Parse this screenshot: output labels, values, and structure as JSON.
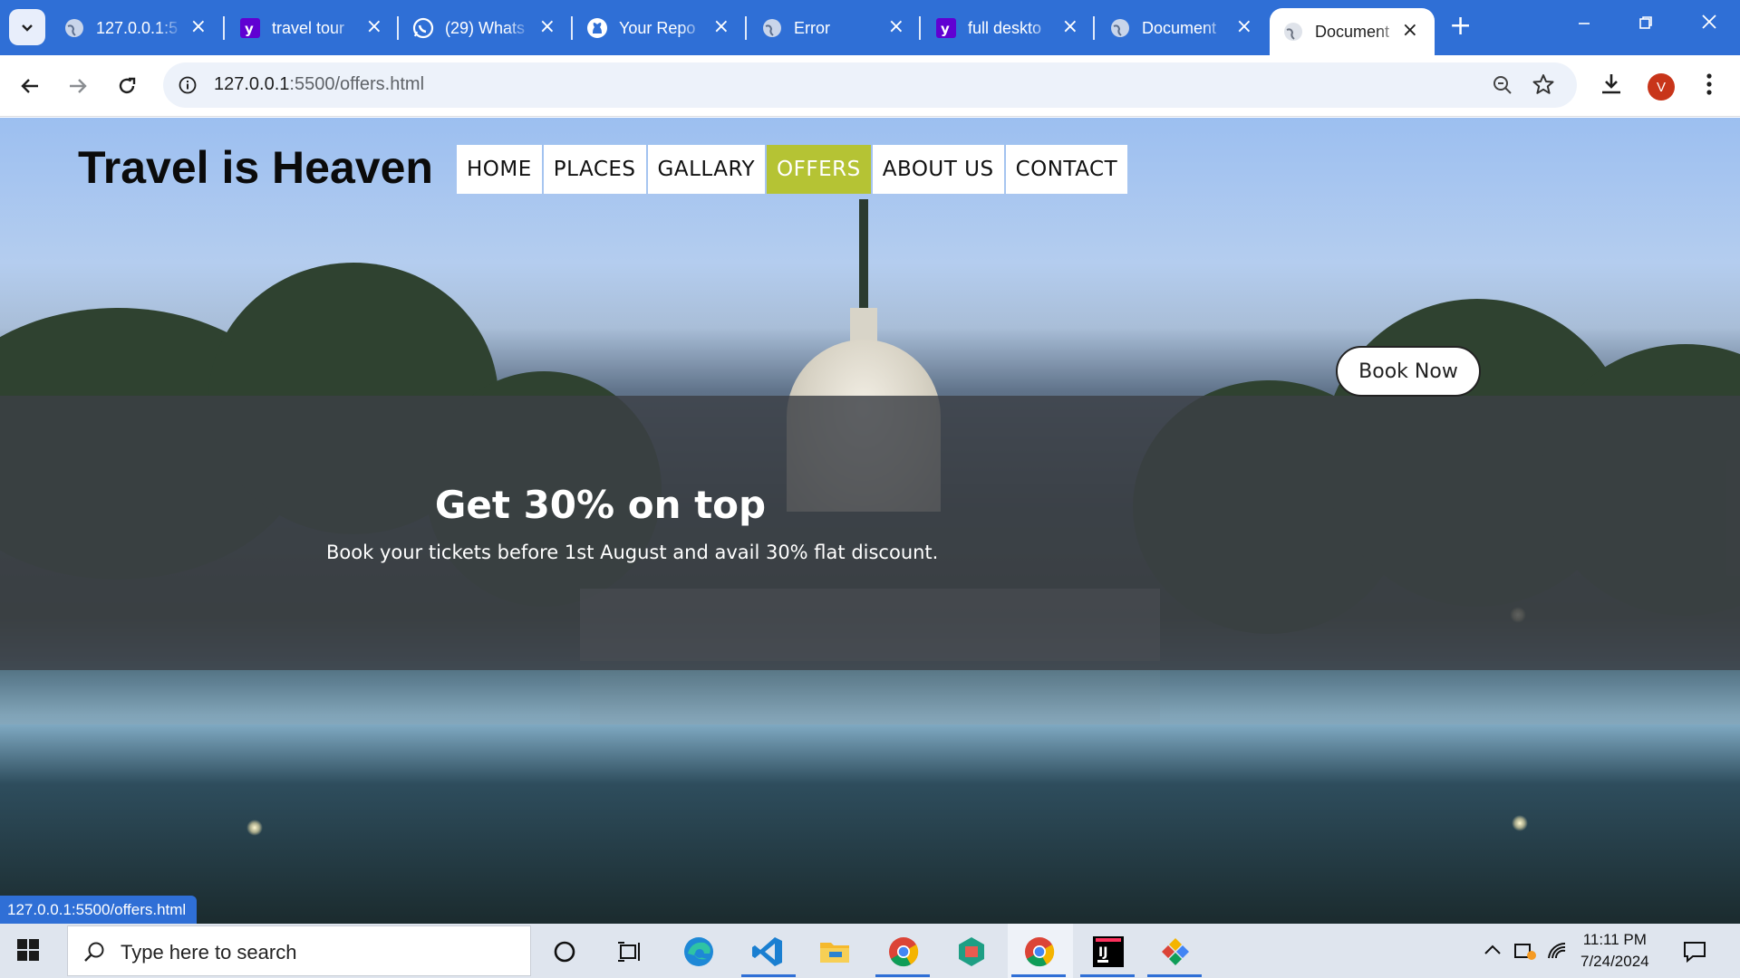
{
  "browser": {
    "tabs": [
      {
        "title": "127.0.0.1:5",
        "favicon": "globe-icon"
      },
      {
        "title": "travel tour",
        "favicon": "yahoo-icon"
      },
      {
        "title": "(29) Whats",
        "favicon": "whatsapp-icon"
      },
      {
        "title": "Your Repo",
        "favicon": "github-icon"
      },
      {
        "title": "Error",
        "favicon": "globe-icon"
      },
      {
        "title": "full deskto",
        "favicon": "yahoo-icon"
      },
      {
        "title": "Document",
        "favicon": "globe-icon"
      },
      {
        "title": "Document",
        "favicon": "globe-icon",
        "active": true
      }
    ],
    "url_host": "127.0.0.1",
    "url_rest": ":5500/offers.html",
    "profile_initial": "V",
    "status_url": "127.0.0.1:5500/offers.html"
  },
  "page": {
    "brand": "Travel is Heaven",
    "menu": [
      "HOME",
      "PLACES",
      "GALLARY",
      "OFFERS",
      "ABOUT US",
      "CONTACT"
    ],
    "active_menu": "OFFERS",
    "offer": {
      "title": "Get 30% on top",
      "text": "Book your tickets before 1st August and avail 30% flat discount.",
      "button": "Book Now"
    }
  },
  "taskbar": {
    "search_placeholder": "Type here to search",
    "time": "11:11 PM",
    "date": "7/24/2024"
  },
  "colors": {
    "tab_strip": "#2f6fd6",
    "menu_active": "#b5c334",
    "offer_band": "#3c4046"
  }
}
